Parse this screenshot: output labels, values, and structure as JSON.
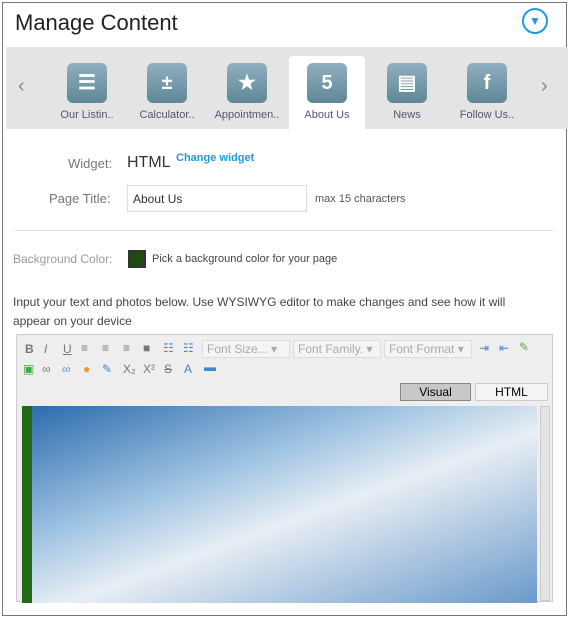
{
  "header": {
    "title": "Manage Content",
    "menu_icon": "chevron-down-circle-icon"
  },
  "tabs": [
    {
      "label": "Our Listin..",
      "icon": "clipboard-list-icon",
      "glyph": "☰"
    },
    {
      "label": "Calculator..",
      "icon": "calculator-icon",
      "glyph": "±"
    },
    {
      "label": "Appointmen..",
      "icon": "appointment-star-icon",
      "glyph": "★"
    },
    {
      "label": "About Us",
      "icon": "html5-icon",
      "glyph": "5",
      "active": true
    },
    {
      "label": "News",
      "icon": "newspaper-icon",
      "glyph": "▤"
    },
    {
      "label": "Follow Us..",
      "icon": "facebook-icon",
      "glyph": "f"
    }
  ],
  "form": {
    "widget_label": "Widget:",
    "widget_value": "HTML",
    "change_widget": "Change widget",
    "page_title_label": "Page Title:",
    "page_title_value": "About Us",
    "page_title_hint": "max 15 characters",
    "bg_label": "Background Color:",
    "bg_hint": "Pick a background color for your page",
    "bg_color": "#1f4a12"
  },
  "instructions": "Input your text and photos below. Use WYSIWYG editor to make changes and see how it will appear on your device",
  "editor": {
    "font_size": "Font Size...",
    "font_family": "Font Family.",
    "font_format": "Font Format",
    "visual_tab": "Visual",
    "html_tab": "HTML"
  }
}
